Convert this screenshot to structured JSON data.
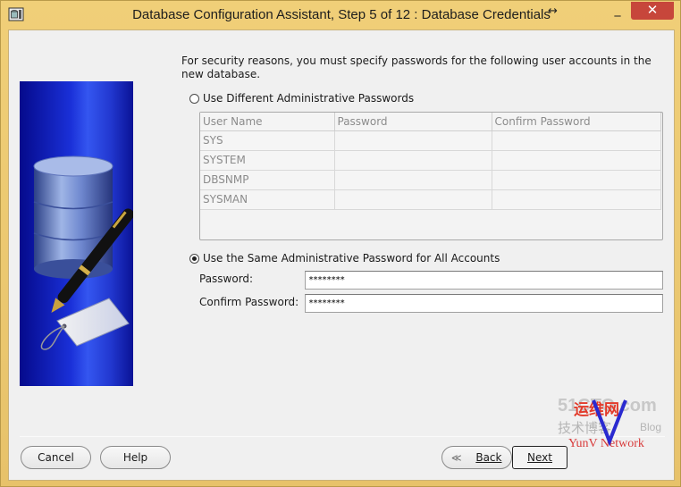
{
  "window": {
    "title": "Database Configuration Assistant, Step 5 of 12 : Database Credentials",
    "resize_icon": "↔",
    "minimize_label": "_",
    "close_label": "✕"
  },
  "content": {
    "intro": "For security reasons, you must specify passwords for the following user accounts in the new database.",
    "option_different": {
      "label": "Use Different Administrative Passwords",
      "selected": false
    },
    "grid": {
      "columns": [
        "User Name",
        "Password",
        "Confirm Password"
      ],
      "rows": [
        {
          "user": "SYS",
          "password": "",
          "confirm": ""
        },
        {
          "user": "SYSTEM",
          "password": "",
          "confirm": ""
        },
        {
          "user": "DBSNMP",
          "password": "",
          "confirm": ""
        },
        {
          "user": "SYSMAN",
          "password": "",
          "confirm": ""
        }
      ]
    },
    "option_same": {
      "label": "Use the Same Administrative Password for All Accounts",
      "selected": true
    },
    "password_label": "Password:",
    "password_value": "********",
    "confirm_label": "Confirm Password:",
    "confirm_value": "********"
  },
  "buttons": {
    "cancel": "Cancel",
    "help": "Help",
    "back_arrow": "≪",
    "back": "Back",
    "next": "Next"
  },
  "watermark": {
    "site": "51CTO.com",
    "cn1": "运维网",
    "cn2": "技术博客",
    "brand": "YunV Network",
    "blog": "Blog"
  },
  "colors": {
    "title_bar": "#e7c26a",
    "close_button": "#c7463b",
    "wizard_image_blue": "#1a30d8"
  }
}
